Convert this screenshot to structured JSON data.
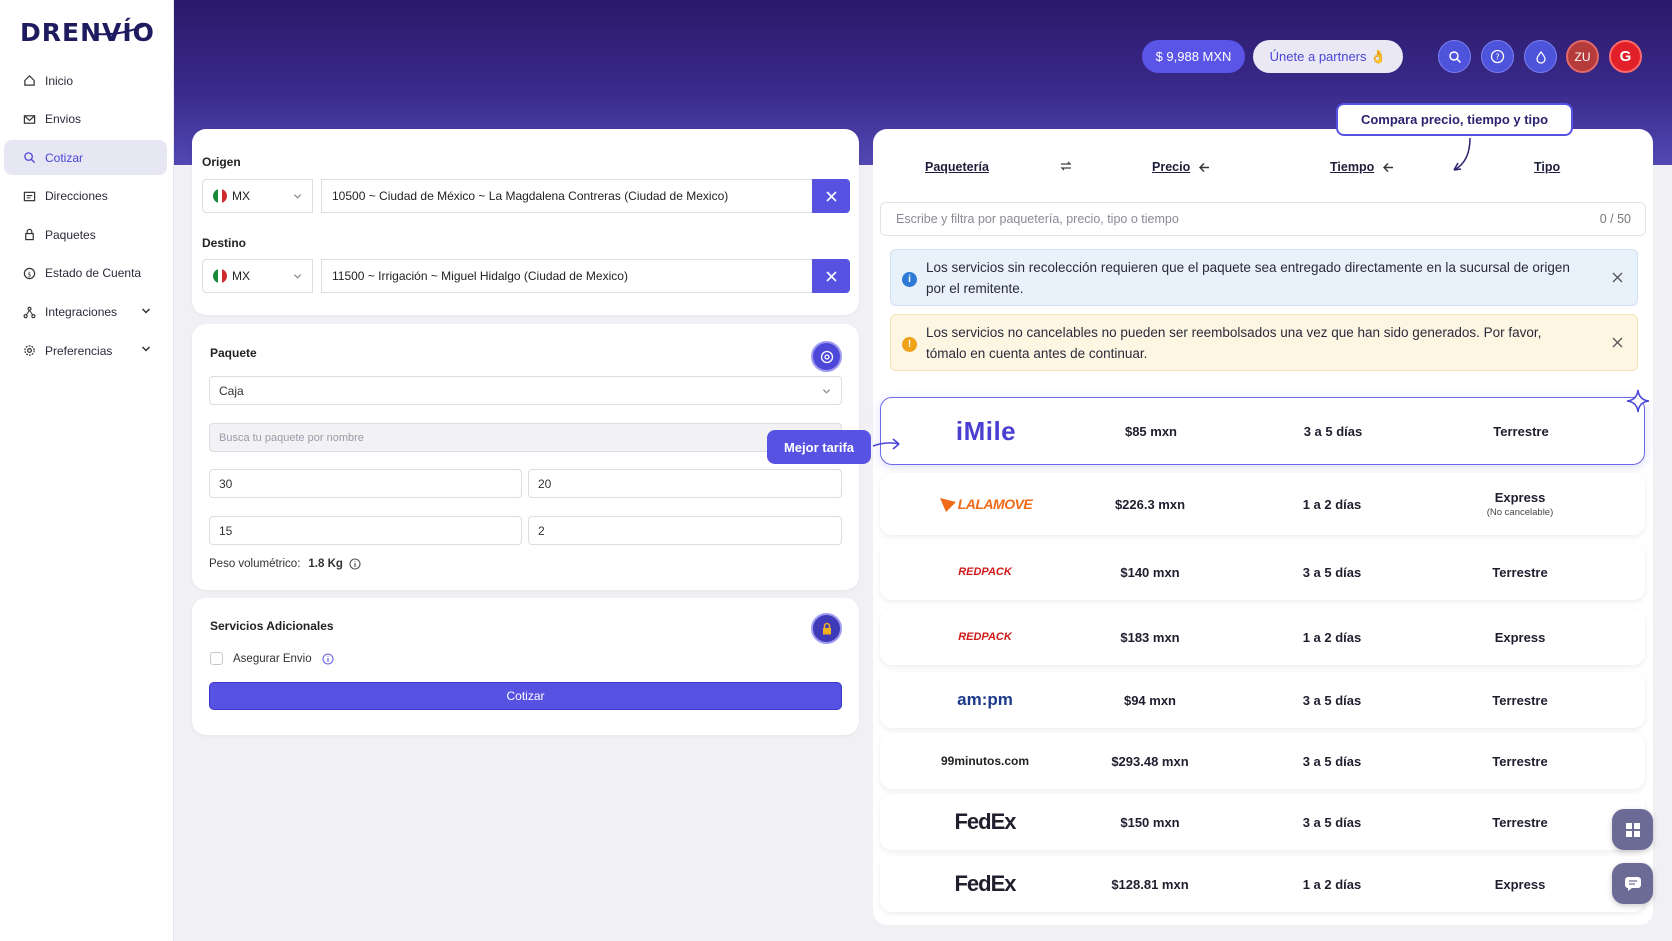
{
  "app": {
    "logo_text": "DRENVÍO"
  },
  "sidebar": {
    "items": [
      {
        "label": "Inicio",
        "icon": "home-icon"
      },
      {
        "label": "Envios",
        "icon": "mail-icon"
      },
      {
        "label": "Cotizar",
        "icon": "search-icon",
        "active": true
      },
      {
        "label": "Direcciones",
        "icon": "address-card-icon"
      },
      {
        "label": "Paquetes",
        "icon": "lock-icon"
      },
      {
        "label": "Estado de Cuenta",
        "icon": "dollar-circle-icon"
      },
      {
        "label": "Integraciones",
        "icon": "integrations-icon",
        "expandable": true
      },
      {
        "label": "Preferencias",
        "icon": "gear-icon",
        "expandable": true
      }
    ]
  },
  "header": {
    "balance": "$ 9,988 MXN",
    "partners": "Únete a partners 👌",
    "avatar_initials": "ZU",
    "g_initial": "G"
  },
  "origin": {
    "title": "Origen",
    "country": "MX",
    "address": "10500 ~ Ciudad de México ~ La Magdalena Contreras (Ciudad de Mexico)"
  },
  "destination": {
    "title": "Destino",
    "country": "MX",
    "address": "11500 ~ Irrigación ~ Miguel Hidalgo (Ciudad de Mexico)"
  },
  "package": {
    "title": "Paquete",
    "type": "Caja",
    "search_placeholder": "Busca tu paquete por nombre",
    "length": "30",
    "width": "20",
    "height": "15",
    "weight": "2",
    "volumetric_label": "Peso volumétrico:",
    "volumetric_value": "1.8 Kg"
  },
  "extras": {
    "title": "Servicios Adicionales",
    "insure_label": "Asegurar Envio",
    "quote_button": "Cotizar"
  },
  "results": {
    "tabs": {
      "carrier": "Paquetería",
      "price": "Precio",
      "time": "Tiempo",
      "type": "Tipo"
    },
    "filter_placeholder": "Escribe y filtra por paquetería, precio, tipo o tiempo",
    "filter_count": "0 / 50",
    "info_alert": "Los servicios sin recolección requieren que el paquete sea entregado directamente en la sucursal de origen por el remitente.",
    "warn_alert": "Los servicios no cancelables no pueden ser reembolsados una vez que han sido generados. Por favor, tómalo en cuenta antes de continuar.",
    "rows": [
      {
        "carrier": "iMile",
        "price": "$85 mxn",
        "time": "3 a 5 días",
        "type": "Terrestre",
        "note": ""
      },
      {
        "carrier": "LALAMOVE",
        "price": "$226.3 mxn",
        "time": "1 a 2 días",
        "type": "Express",
        "note": "(No cancelable)"
      },
      {
        "carrier": "REDPACK",
        "price": "$140 mxn",
        "time": "3 a 5 días",
        "type": "Terrestre",
        "note": ""
      },
      {
        "carrier": "REDPACK",
        "price": "$183 mxn",
        "time": "1 a 2 días",
        "type": "Express",
        "note": ""
      },
      {
        "carrier": "am:pm",
        "price": "$94 mxn",
        "time": "3 a 5 días",
        "type": "Terrestre",
        "note": ""
      },
      {
        "carrier": "99minutos.com",
        "price": "$293.48 mxn",
        "time": "3 a 5 días",
        "type": "Terrestre",
        "note": ""
      },
      {
        "carrier": "FedEx",
        "price": "$150 mxn",
        "time": "3 a 5 días",
        "type": "Terrestre",
        "note": ""
      },
      {
        "carrier": "FedEx",
        "price": "$128.81 mxn",
        "time": "1 a 2 días",
        "type": "Express",
        "note": ""
      }
    ]
  },
  "tooltips": {
    "compare": "Compara precio, tiempo y tipo",
    "best": "Mejor tarifa"
  },
  "colors": {
    "accent": "#5852e2",
    "header": "#2a1a6b"
  }
}
